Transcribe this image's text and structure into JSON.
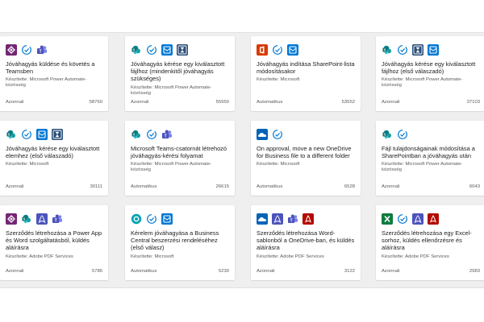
{
  "cards": [
    {
      "title": "Jóváhagyás küldése és követés a Teamsben",
      "author": "Készítette: Microsoft Power Automate-közösség",
      "trigger": "Azonnali",
      "count": "58760",
      "icons": [
        "power-apps-icon",
        "approvals-icon",
        "teams-icon"
      ]
    },
    {
      "title": "Jóváhagyás kérése egy kiválasztott fájlhoz (mindenkitől jóváhagyás szükséges)",
      "author": "Készítette: Microsoft Power Automate-közösség",
      "trigger": "Azonnali",
      "count": "55950",
      "icons": [
        "sharepoint-icon",
        "approvals-icon",
        "outlook-icon",
        "hourglass-icon"
      ]
    },
    {
      "title": "Jóváhagyás indítása SharePoint-lista módosításakor",
      "author": "Készítette: Microsoft",
      "trigger": "Automatikus",
      "count": "53552",
      "icons": [
        "office-icon",
        "approvals-icon",
        "outlook-icon"
      ]
    },
    {
      "title": "Jóváhagyás kérése egy kiválasztott fájlhoz (első válaszadó)",
      "author": "Készítette: Microsoft Power Automate-közösség",
      "trigger": "Azonnali",
      "count": "37103",
      "icons": [
        "sharepoint-icon",
        "approvals-icon",
        "hourglass-icon",
        "outlook-icon"
      ]
    },
    {
      "title": "Jóváhagyás kérése egy kiválasztott elemhez (első válaszadó)",
      "author": "Készítette: Microsoft",
      "trigger": "Azonnali",
      "count": "30111",
      "icons": [
        "sharepoint-icon",
        "approvals-icon",
        "outlook-icon",
        "hourglass-icon"
      ]
    },
    {
      "title": "Microsoft Teams-csatornát létrehozó jóváhagyás-kérési folyamat",
      "author": "Készítette: Microsoft Power Automate-közösség",
      "trigger": "Automatikus",
      "count": "26615",
      "icons": [
        "sharepoint-icon",
        "approvals-icon",
        "teams-icon"
      ]
    },
    {
      "title": "On approval, move a new OneDrive for Business file to a different folder",
      "author": "Készítette: Microsoft",
      "trigger": "Automatikus",
      "count": "6528",
      "icons": [
        "onedrive-icon",
        "approvals-icon"
      ]
    },
    {
      "title": "Fájl tulajdonságainak módosítása a SharePointban a jóváhagyás után",
      "author": "Készítette: Microsoft Power Automate-közösség",
      "trigger": "Azonnali",
      "count": "6043",
      "icons": [
        "sharepoint-icon",
        "approvals-icon"
      ]
    },
    {
      "title": "Szerződés létrehozása a Power App és Word szolgáltatásból, küldés aláírásra",
      "author": "Készítette: Adobe PDF Services",
      "trigger": "Azonnali",
      "count": "5786",
      "icons": [
        "power-apps-icon",
        "sharepoint-icon",
        "adobe-pdf-icon",
        "teams-icon"
      ]
    },
    {
      "title": "Kérelem jóváhagyása a Business Central beszerzési rendeléséhez (első válasz)",
      "author": "Készítette: Microsoft",
      "trigger": "Automatikus",
      "count": "5230",
      "icons": [
        "business-central-icon",
        "approvals-icon",
        "outlook-icon"
      ]
    },
    {
      "title": "Szerződés létrehozása Word-sablonból a OneDrive-ban, és küldés aláírásra",
      "author": "Készítette: Adobe PDF Services",
      "trigger": "Azonnali",
      "count": "3122",
      "icons": [
        "onedrive-icon",
        "adobe-pdf-icon",
        "teams-icon",
        "acrobat-icon"
      ]
    },
    {
      "title": "Szerződés létrehozása egy Excel-sorhoz, küldés ellenőrzésre és aláírásra",
      "author": "Készítette: Adobe PDF Services",
      "trigger": "Azonnali",
      "count": "2983",
      "icons": [
        "excel-icon",
        "approvals-icon",
        "adobe-pdf-icon",
        "acrobat-icon"
      ]
    }
  ],
  "colors": {
    "power_apps": "#742774",
    "sharepoint": "#038387",
    "approvals": "#0078d4",
    "teams": "#4b53bc",
    "outlook": "#0078d4",
    "hourglass": "#1f3a5f",
    "office": "#d83b01",
    "onedrive": "#0364b8",
    "adobe": "#b30b00",
    "excel": "#107c41",
    "business_central": "#00a4b4"
  }
}
